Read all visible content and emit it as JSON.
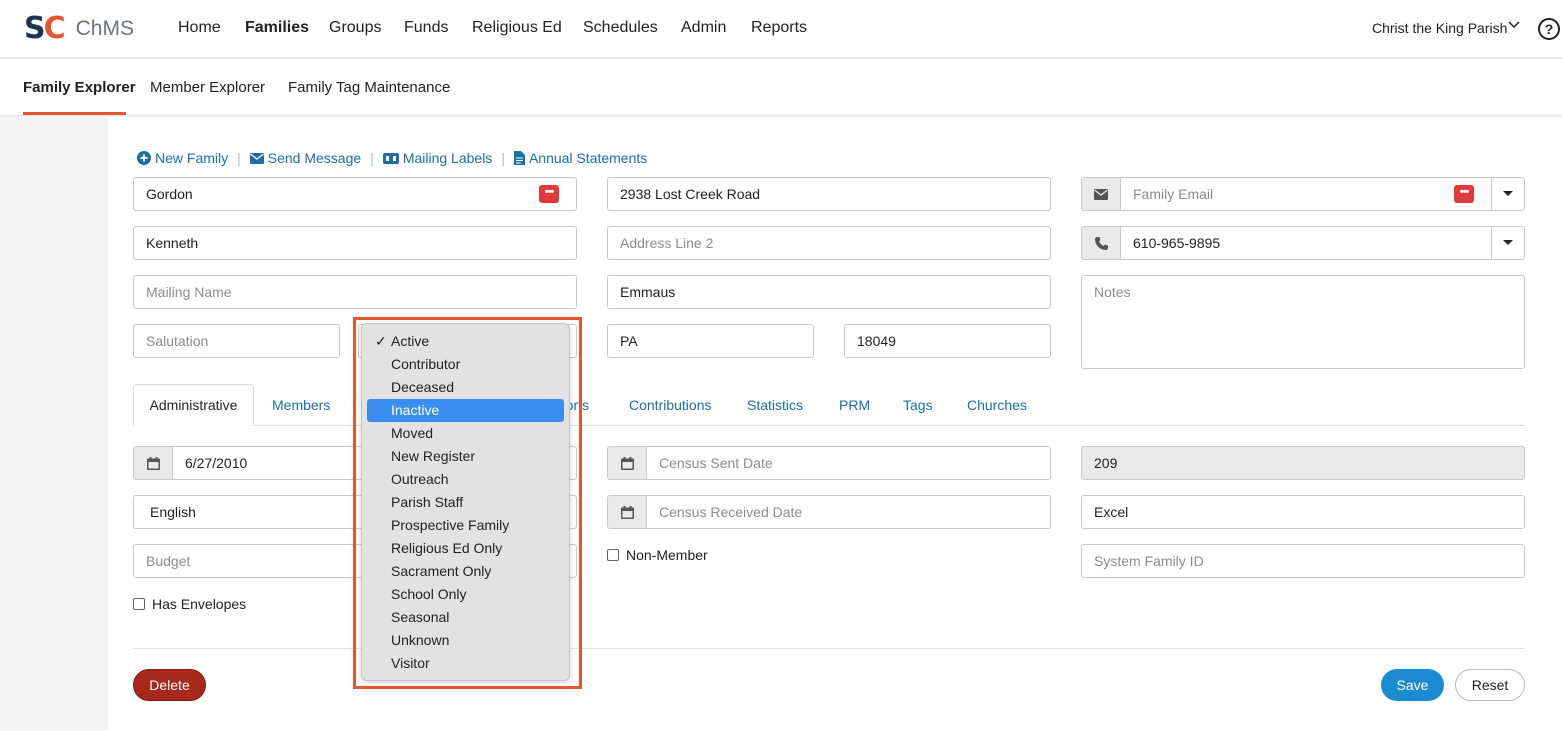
{
  "app": {
    "logo": "SC",
    "name": "ChMS"
  },
  "nav": [
    {
      "label": "Home"
    },
    {
      "label": "Families",
      "active": true
    },
    {
      "label": "Groups"
    },
    {
      "label": "Funds"
    },
    {
      "label": "Religious Ed"
    },
    {
      "label": "Schedules"
    },
    {
      "label": "Admin"
    },
    {
      "label": "Reports"
    }
  ],
  "parish": "Christ the King Parish",
  "subnav": [
    {
      "label": "Family Explorer",
      "active": true
    },
    {
      "label": "Member Explorer"
    },
    {
      "label": "Family Tag Maintenance"
    }
  ],
  "actions": {
    "new_family": "New Family",
    "send_message": "Send Message",
    "mailing_labels": "Mailing Labels",
    "annual_statements": "Annual Statements"
  },
  "form": {
    "last_name": "Gordon",
    "first_name": "Kenneth",
    "mailing_name_placeholder": "Mailing Name",
    "salutation_placeholder": "Salutation",
    "address1": "2938 Lost Creek Road",
    "address2_placeholder": "Address Line 2",
    "city": "Emmaus",
    "state": "PA",
    "zip": "18049",
    "email_placeholder": "Family Email",
    "phone": "610-965-9895",
    "notes_placeholder": "Notes"
  },
  "tabs": [
    "Administrative",
    "Members",
    "Reports",
    "Contributions",
    "Statistics",
    "PRM",
    "Tags",
    "Churches"
  ],
  "admin": {
    "registered_date": "6/27/2010",
    "language": "English",
    "budget_placeholder": "Budget",
    "census_sent_placeholder": "Census Sent Date",
    "census_received_placeholder": "Census Received Date",
    "non_member": "Non-Member",
    "has_envelopes": "Has Envelopes",
    "family_number": "209",
    "source": "Excel",
    "system_id_placeholder": "System Family ID"
  },
  "status_dropdown": {
    "checked": "Active",
    "highlighted": "Inactive",
    "options": [
      "Active",
      "Contributor",
      "Deceased",
      "Inactive",
      "Moved",
      "New Register",
      "Outreach",
      "Parish Staff",
      "Prospective Family",
      "Religious Ed Only",
      "Sacrament Only",
      "School Only",
      "Seasonal",
      "Unknown",
      "Visitor"
    ]
  },
  "buttons": {
    "delete": "Delete",
    "save": "Save",
    "reset": "Reset"
  },
  "colors": {
    "accent": "#e4572e",
    "link": "#1a6fa8",
    "save": "#1a8bd1",
    "delete": "#a8281c"
  }
}
